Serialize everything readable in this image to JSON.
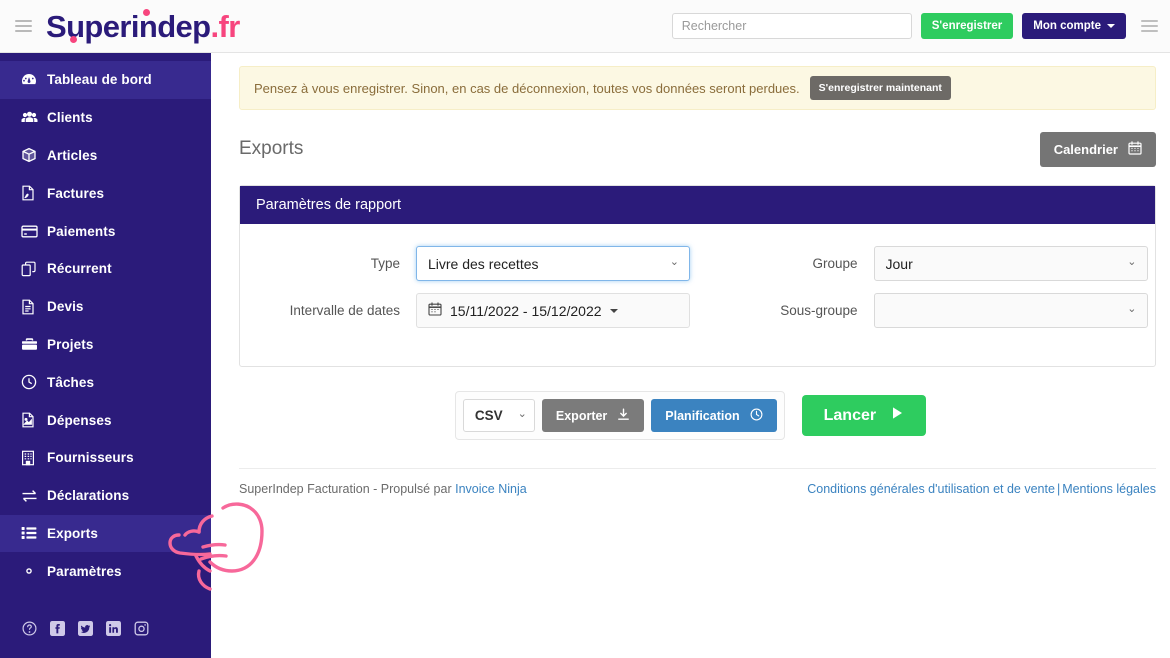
{
  "topbar": {
    "menu_icon": "hamburger-icon",
    "brand": "Superindep",
    "brand_tld": ".fr",
    "search_placeholder": "Rechercher",
    "search_value": "",
    "register_label": "S'enregistrer",
    "account_label": "Mon compte",
    "right_menu_icon": "hamburger-icon"
  },
  "sidebar": {
    "items": [
      {
        "label": "Tableau de bord",
        "icon": "dashboard-icon",
        "active": true
      },
      {
        "label": "Clients",
        "icon": "users-icon",
        "active": false
      },
      {
        "label": "Articles",
        "icon": "box-icon",
        "active": false
      },
      {
        "label": "Factures",
        "icon": "invoice-icon",
        "active": false
      },
      {
        "label": "Paiements",
        "icon": "credit-card-icon",
        "active": false
      },
      {
        "label": "Récurrent",
        "icon": "recurring-icon",
        "active": false
      },
      {
        "label": "Devis",
        "icon": "quote-icon",
        "active": false
      },
      {
        "label": "Projets",
        "icon": "briefcase-icon",
        "active": false
      },
      {
        "label": "Tâches",
        "icon": "clock-icon",
        "active": false
      },
      {
        "label": "Dépenses",
        "icon": "expense-icon",
        "active": false
      },
      {
        "label": "Fournisseurs",
        "icon": "building-icon",
        "active": false
      },
      {
        "label": "Déclarations",
        "icon": "exchange-icon",
        "active": false
      },
      {
        "label": "Exports",
        "icon": "list-icon",
        "active": true
      },
      {
        "label": "Paramètres",
        "icon": "gear-icon",
        "active": false
      }
    ],
    "social": [
      {
        "name": "help-icon"
      },
      {
        "name": "facebook-icon"
      },
      {
        "name": "twitter-icon"
      },
      {
        "name": "linkedin-icon"
      },
      {
        "name": "instagram-icon"
      }
    ]
  },
  "alert": {
    "message": "Pensez à vous enregistrer. Sinon, en cas de déconnexion, toutes vos données seront perdues.",
    "button_label": "S'enregistrer maintenant"
  },
  "page": {
    "title": "Exports",
    "calendar_button": "Calendrier"
  },
  "panel": {
    "title": "Paramètres de rapport",
    "fields": {
      "type_label": "Type",
      "type_value": "Livre des recettes",
      "date_range_label": "Intervalle de dates",
      "date_range_value": "15/11/2022 - 15/12/2022",
      "group_label": "Groupe",
      "group_value": "Jour",
      "subgroup_label": "Sous-groupe",
      "subgroup_value": ""
    }
  },
  "actions": {
    "format_value": "CSV",
    "export_label": "Exporter",
    "schedule_label": "Planification",
    "run_label": "Lancer"
  },
  "footer": {
    "text": "SuperIndep Facturation - Propulsé par ",
    "link_label": "Invoice Ninja",
    "terms_label": "Conditions générales d'utilisation et de vente",
    "separator": "|",
    "legal_label": "Mentions légales"
  },
  "colors": {
    "brand_navy": "#2b1b7a",
    "accent_pink": "#f7457e",
    "green": "#2ecc5f",
    "blue": "#3b83c0",
    "gray": "#757575",
    "alert_bg": "#fcf8e3",
    "alert_text": "#8a6d3b",
    "annotation_pink": "#f7689a"
  }
}
